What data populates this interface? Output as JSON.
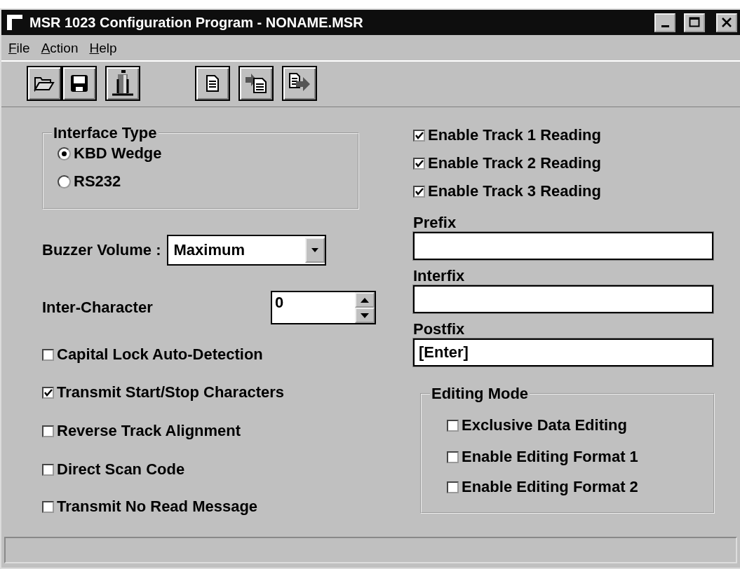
{
  "window": {
    "title": "MSR 1023 Configuration Program - NONAME.MSR"
  },
  "menu": [
    "File",
    "Action",
    "Help"
  ],
  "interface_type": {
    "title": "Interface Type",
    "options": [
      {
        "label": "KBD Wedge",
        "selected": true
      },
      {
        "label": "RS232",
        "selected": false
      }
    ]
  },
  "buzzer_volume": {
    "label": "Buzzer Volume :",
    "value": "Maximum"
  },
  "inter_character": {
    "label": "Inter-Character",
    "value": "0"
  },
  "left_options": [
    {
      "label": "Capital Lock Auto-Detection",
      "checked": false
    },
    {
      "label": "Transmit Start/Stop Characters",
      "checked": true
    },
    {
      "label": "Reverse Track Alignment",
      "checked": false
    },
    {
      "label": "Direct Scan Code",
      "checked": false
    },
    {
      "label": "Transmit No Read Message",
      "checked": false
    }
  ],
  "tracks": [
    {
      "label": "Enable Track 1 Reading",
      "checked": true
    },
    {
      "label": "Enable Track 2 Reading",
      "checked": true
    },
    {
      "label": "Enable Track 3 Reading",
      "checked": true
    }
  ],
  "fields": [
    {
      "label": "Prefix"
    },
    {
      "label": "Interfix"
    },
    {
      "label": "Postfix",
      "value": "[Enter]"
    }
  ],
  "editing_mode": {
    "title": "Editing Mode",
    "options": [
      {
        "label": "Exclusive Data Editing",
        "checked": false
      },
      {
        "label": "Enable Editing Format 1",
        "checked": false
      },
      {
        "label": "Enable Editing Format 2",
        "checked": false
      }
    ]
  }
}
